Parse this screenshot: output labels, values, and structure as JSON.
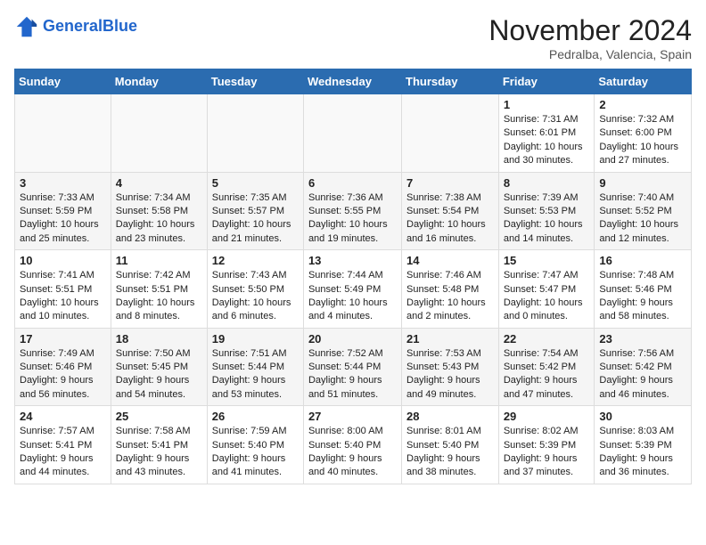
{
  "header": {
    "logo_line1": "General",
    "logo_line2": "Blue",
    "month": "November 2024",
    "location": "Pedralba, Valencia, Spain"
  },
  "weekdays": [
    "Sunday",
    "Monday",
    "Tuesday",
    "Wednesday",
    "Thursday",
    "Friday",
    "Saturday"
  ],
  "weeks": [
    [
      {
        "day": "",
        "info": ""
      },
      {
        "day": "",
        "info": ""
      },
      {
        "day": "",
        "info": ""
      },
      {
        "day": "",
        "info": ""
      },
      {
        "day": "",
        "info": ""
      },
      {
        "day": "1",
        "info": "Sunrise: 7:31 AM\nSunset: 6:01 PM\nDaylight: 10 hours and 30 minutes."
      },
      {
        "day": "2",
        "info": "Sunrise: 7:32 AM\nSunset: 6:00 PM\nDaylight: 10 hours and 27 minutes."
      }
    ],
    [
      {
        "day": "3",
        "info": "Sunrise: 7:33 AM\nSunset: 5:59 PM\nDaylight: 10 hours and 25 minutes."
      },
      {
        "day": "4",
        "info": "Sunrise: 7:34 AM\nSunset: 5:58 PM\nDaylight: 10 hours and 23 minutes."
      },
      {
        "day": "5",
        "info": "Sunrise: 7:35 AM\nSunset: 5:57 PM\nDaylight: 10 hours and 21 minutes."
      },
      {
        "day": "6",
        "info": "Sunrise: 7:36 AM\nSunset: 5:55 PM\nDaylight: 10 hours and 19 minutes."
      },
      {
        "day": "7",
        "info": "Sunrise: 7:38 AM\nSunset: 5:54 PM\nDaylight: 10 hours and 16 minutes."
      },
      {
        "day": "8",
        "info": "Sunrise: 7:39 AM\nSunset: 5:53 PM\nDaylight: 10 hours and 14 minutes."
      },
      {
        "day": "9",
        "info": "Sunrise: 7:40 AM\nSunset: 5:52 PM\nDaylight: 10 hours and 12 minutes."
      }
    ],
    [
      {
        "day": "10",
        "info": "Sunrise: 7:41 AM\nSunset: 5:51 PM\nDaylight: 10 hours and 10 minutes."
      },
      {
        "day": "11",
        "info": "Sunrise: 7:42 AM\nSunset: 5:51 PM\nDaylight: 10 hours and 8 minutes."
      },
      {
        "day": "12",
        "info": "Sunrise: 7:43 AM\nSunset: 5:50 PM\nDaylight: 10 hours and 6 minutes."
      },
      {
        "day": "13",
        "info": "Sunrise: 7:44 AM\nSunset: 5:49 PM\nDaylight: 10 hours and 4 minutes."
      },
      {
        "day": "14",
        "info": "Sunrise: 7:46 AM\nSunset: 5:48 PM\nDaylight: 10 hours and 2 minutes."
      },
      {
        "day": "15",
        "info": "Sunrise: 7:47 AM\nSunset: 5:47 PM\nDaylight: 10 hours and 0 minutes."
      },
      {
        "day": "16",
        "info": "Sunrise: 7:48 AM\nSunset: 5:46 PM\nDaylight: 9 hours and 58 minutes."
      }
    ],
    [
      {
        "day": "17",
        "info": "Sunrise: 7:49 AM\nSunset: 5:46 PM\nDaylight: 9 hours and 56 minutes."
      },
      {
        "day": "18",
        "info": "Sunrise: 7:50 AM\nSunset: 5:45 PM\nDaylight: 9 hours and 54 minutes."
      },
      {
        "day": "19",
        "info": "Sunrise: 7:51 AM\nSunset: 5:44 PM\nDaylight: 9 hours and 53 minutes."
      },
      {
        "day": "20",
        "info": "Sunrise: 7:52 AM\nSunset: 5:44 PM\nDaylight: 9 hours and 51 minutes."
      },
      {
        "day": "21",
        "info": "Sunrise: 7:53 AM\nSunset: 5:43 PM\nDaylight: 9 hours and 49 minutes."
      },
      {
        "day": "22",
        "info": "Sunrise: 7:54 AM\nSunset: 5:42 PM\nDaylight: 9 hours and 47 minutes."
      },
      {
        "day": "23",
        "info": "Sunrise: 7:56 AM\nSunset: 5:42 PM\nDaylight: 9 hours and 46 minutes."
      }
    ],
    [
      {
        "day": "24",
        "info": "Sunrise: 7:57 AM\nSunset: 5:41 PM\nDaylight: 9 hours and 44 minutes."
      },
      {
        "day": "25",
        "info": "Sunrise: 7:58 AM\nSunset: 5:41 PM\nDaylight: 9 hours and 43 minutes."
      },
      {
        "day": "26",
        "info": "Sunrise: 7:59 AM\nSunset: 5:40 PM\nDaylight: 9 hours and 41 minutes."
      },
      {
        "day": "27",
        "info": "Sunrise: 8:00 AM\nSunset: 5:40 PM\nDaylight: 9 hours and 40 minutes."
      },
      {
        "day": "28",
        "info": "Sunrise: 8:01 AM\nSunset: 5:40 PM\nDaylight: 9 hours and 38 minutes."
      },
      {
        "day": "29",
        "info": "Sunrise: 8:02 AM\nSunset: 5:39 PM\nDaylight: 9 hours and 37 minutes."
      },
      {
        "day": "30",
        "info": "Sunrise: 8:03 AM\nSunset: 5:39 PM\nDaylight: 9 hours and 36 minutes."
      }
    ]
  ]
}
